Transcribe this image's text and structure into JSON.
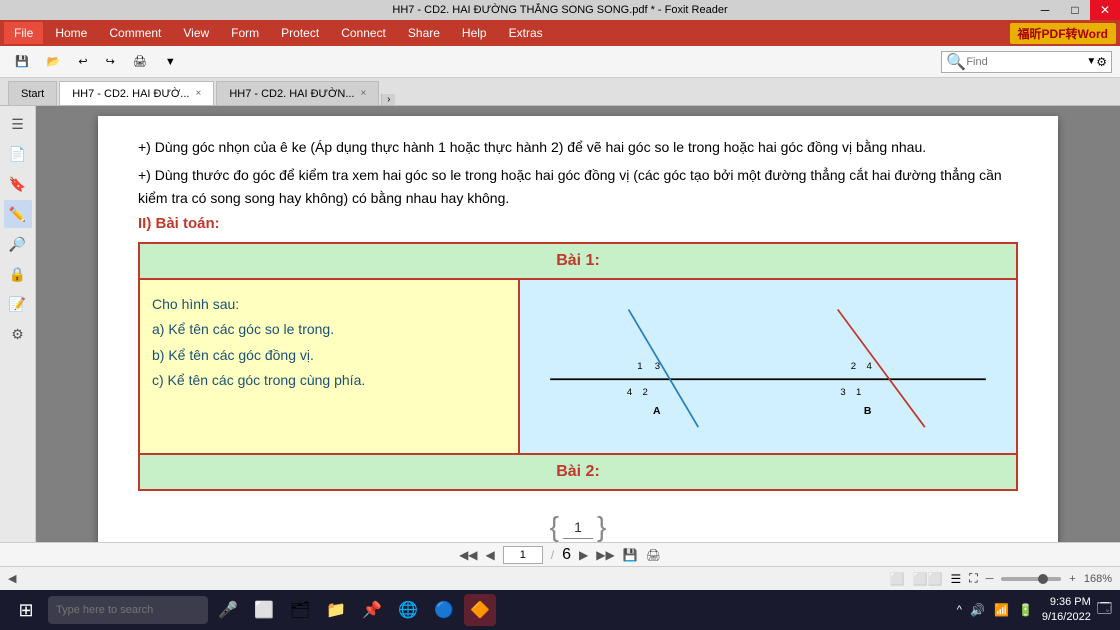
{
  "titlebar": {
    "title": "HH7 - CD2. HAI ĐƯỜNG THẲNG SONG SONG.pdf * - Foxit Reader",
    "min": "─",
    "max": "□",
    "close": "✕"
  },
  "menu": {
    "file": "File",
    "home": "Home",
    "comment": "Comment",
    "view": "View",
    "form": "Form",
    "protect": "Protect",
    "connect": "Connect",
    "share": "Share",
    "help": "Help",
    "extras": "Extras"
  },
  "foxit_badge": "福昕PDF转Word",
  "search": {
    "placeholder": "Find"
  },
  "tabs": {
    "start": "Start",
    "tab1_short": "HH7 - CD2. HAI ĐƯỜ...",
    "tab1_short2": "HH7 - CD2. HAI ĐƯỜN...",
    "tab1_close": "×"
  },
  "left_panel": {
    "icons": [
      "☰",
      "📄",
      "🔖",
      "✏️",
      "🔍",
      "🔒",
      "📝",
      "⚙"
    ]
  },
  "content": {
    "intro_text1": "+) Dùng góc nhọn của ê ke (Áp dụng thực hành 1 hoặc thực hành 2) để vẽ hai góc so le trong hoặc hai góc đồng vị bằng nhau.",
    "intro_text2": "+) Dùng thước đo góc để kiểm tra xem hai góc so le trong hoặc hai góc đồng vị (các góc tạo bởi một đường thẳng cắt hai đường thẳng cần kiểm tra có song song hay không) có bằng nhau hay không.",
    "section_title": "II) Bài toán:",
    "bai1_header": "Bài 1:",
    "bai1_left_text": "Cho hình sau:",
    "bai1_a": "a) Kể tên các góc so le trong.",
    "bai1_b": "b) Kể tên các góc đồng vị.",
    "bai1_c": "c) Kể tên các góc trong cùng phía.",
    "bai2_header": "Bài 2:",
    "page_number": "1",
    "page_total": "6"
  },
  "footer_nav": {
    "first": "◀",
    "prev": "◀",
    "next": "▶",
    "last": "▶",
    "page_of": "1 / 6"
  },
  "status": {
    "scroll_left": "◀",
    "zoom_level": "168%",
    "zoom_minus": "─",
    "zoom_plus": "+"
  },
  "taskbar": {
    "start_icon": "⊞",
    "search_placeholder": "Type here to search",
    "icons": [
      "🎤",
      "⬜",
      "🗂",
      "📁",
      "📌",
      "🌐",
      "🔵",
      "🔶"
    ],
    "sys_icons": [
      "^",
      "🔊",
      "📶"
    ],
    "time": "9:36 PM",
    "date": "9/16/2022"
  },
  "diagram": {
    "label_a": "A",
    "label_b": "B",
    "numbers_left": [
      "1",
      "3",
      "4",
      "2"
    ],
    "numbers_right": [
      "2",
      "4",
      "3",
      "1"
    ]
  }
}
